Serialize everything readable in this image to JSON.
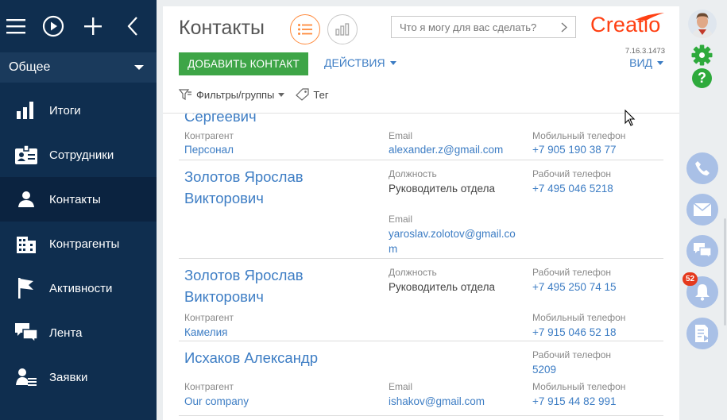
{
  "sidebar": {
    "workspace": "Общее",
    "items": [
      {
        "label": "Итоги"
      },
      {
        "label": "Сотрудники"
      },
      {
        "label": "Контакты"
      },
      {
        "label": "Контрагенты"
      },
      {
        "label": "Активности"
      },
      {
        "label": "Лента"
      },
      {
        "label": "Заявки"
      }
    ]
  },
  "header": {
    "title": "Контакты",
    "search_placeholder": "Что я могу для вас сделать?",
    "logo": "Creatio",
    "version": "7.16.3.1473"
  },
  "toolbar": {
    "add_label": "ДОБАВИТЬ КОНТАКТ",
    "actions_label": "ДЕЙСТВИЯ",
    "view_label": "ВИД",
    "filters_label": "Фильтры/группы",
    "tag_label": "Тег"
  },
  "records": [
    {
      "name_line2": "Сергеевич",
      "account_label": "Контрагент",
      "account": "Персонал",
      "email_label": "Email",
      "email": "alexander.z@gmail.com",
      "phone_label": "Мобильный телефон",
      "phone": "+7 905 190 38 77"
    },
    {
      "name_line1": "Золотов Ярослав",
      "name_line2": "Викторович",
      "position_label": "Должность",
      "position": "Руководитель отдела",
      "phone_label": "Рабочий телефон",
      "phone": "+7 495 046 5218",
      "email_label": "Email",
      "email_line1": "yaroslav.zolotov@gmail.co",
      "email_line2": "m"
    },
    {
      "name_line1": "Золотов Ярослав",
      "name_line2": "Викторович",
      "position_label": "Должность",
      "position": "Руководитель отдела",
      "work_phone_label": "Рабочий телефон",
      "work_phone": "+7 495 250 74 15",
      "account_label": "Контрагент",
      "account": "Камелия",
      "mobile_label": "Мобильный телефон",
      "mobile": "+7 915 046 52 18"
    },
    {
      "name": "Исхаков Александр",
      "work_phone_label": "Рабочий телефон",
      "work_phone": "5209",
      "account_label": "Контрагент",
      "account": "Our company",
      "email_label": "Email",
      "email": "ishakov@gmail.com",
      "mobile_label": "Мобильный телефон",
      "mobile": "+7 915 44 82 991"
    }
  ],
  "rightbar": {
    "notification_count": "52"
  },
  "colors": {
    "sidebar": "#0f2e4f",
    "accent_green": "#3ea547",
    "link_blue": "#3d7dc4",
    "brand_orange": "#ff4013",
    "comm_icon_bg": "#a9c0e6"
  }
}
